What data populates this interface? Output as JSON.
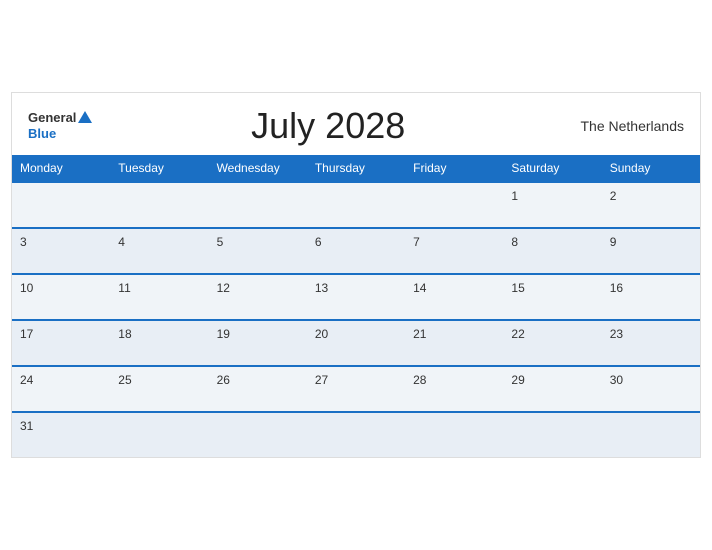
{
  "header": {
    "logo_general": "General",
    "logo_blue": "Blue",
    "title": "July 2028",
    "country": "The Netherlands"
  },
  "weekdays": [
    "Monday",
    "Tuesday",
    "Wednesday",
    "Thursday",
    "Friday",
    "Saturday",
    "Sunday"
  ],
  "weeks": [
    [
      null,
      null,
      null,
      null,
      null,
      "1",
      "2"
    ],
    [
      "3",
      "4",
      "5",
      "6",
      "7",
      "8",
      "9"
    ],
    [
      "10",
      "11",
      "12",
      "13",
      "14",
      "15",
      "16"
    ],
    [
      "17",
      "18",
      "19",
      "20",
      "21",
      "22",
      "23"
    ],
    [
      "24",
      "25",
      "26",
      "27",
      "28",
      "29",
      "30"
    ],
    [
      "31",
      null,
      null,
      null,
      null,
      null,
      null
    ]
  ]
}
